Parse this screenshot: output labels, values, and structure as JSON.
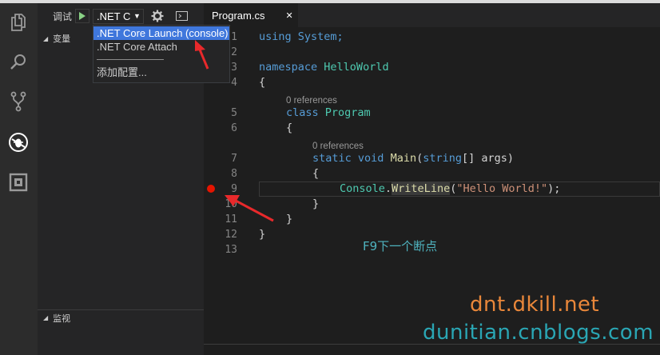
{
  "debug": {
    "label": "调试",
    "config_selected": ".NET C",
    "config_options": [
      ".NET Core Launch (console)",
      ".NET Core Attach",
      "添加配置..."
    ]
  },
  "sidebar": {
    "variables_header": "变量",
    "watch_header": "监视"
  },
  "editor": {
    "tab_label": "Program.cs",
    "code_lens": [
      "0 references",
      "0 references"
    ],
    "line_numbers": [
      "1",
      "2",
      "3",
      "4",
      "5",
      "6",
      "7",
      "8",
      "9",
      "10",
      "11",
      "12",
      "13"
    ],
    "lines": [
      "using System;",
      "",
      "namespace HelloWorld",
      "{",
      "class Program",
      "{",
      "static void Main(string[] args)",
      "{",
      "Console.WriteLine(\"Hello World!\");",
      "}",
      "}",
      "}",
      ""
    ],
    "breakpoint_line": "9"
  },
  "annotation": "F9下一个断点",
  "watermarks": [
    "dnt.dkill.net",
    "dunitian.cnblogs.com"
  ],
  "icons": [
    "explorer-icon",
    "search-icon",
    "source-control-icon",
    "debug-icon",
    "extensions-icon",
    "play-icon",
    "gear-icon",
    "console-icon",
    "close-icon",
    "chevron-down-icon"
  ],
  "colors": {
    "keyword": "#569cd6",
    "type": "#4ec9b0",
    "function": "#dcdcaa",
    "string": "#ce9178",
    "breakpoint": "#e51400",
    "selection": "#3f77dc",
    "arrow": "#e8292b",
    "watermark_orange": "#e9873a",
    "watermark_teal": "#2aa6b4"
  }
}
